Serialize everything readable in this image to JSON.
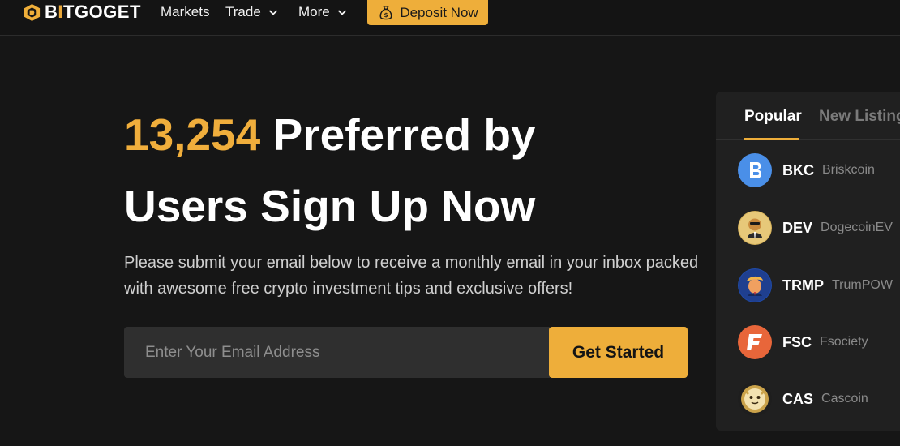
{
  "brand": {
    "name_prefix": "B",
    "name_i": "I",
    "name_suffix": "TGOGET",
    "accent": "#eeae3a"
  },
  "nav": {
    "items": [
      {
        "label": "Markets"
      },
      {
        "label": "Trade"
      },
      {
        "label": "More"
      }
    ],
    "deposit_label": "Deposit Now"
  },
  "hero": {
    "count": "13,254",
    "title_rest_line1": " Preferred by",
    "title_line2": "Users Sign Up Now",
    "subtitle": "Please submit your email below to receive a monthly email in your inbox packed with awesome free crypto investment tips and exclusive offers!",
    "email_placeholder": "Enter Your Email Address",
    "cta_label": "Get Started"
  },
  "panel": {
    "tabs": [
      {
        "label": "Popular",
        "active": true
      },
      {
        "label": "New Listing",
        "active": false
      }
    ],
    "coins": [
      {
        "symbol": "BKC",
        "name": "Briskcoin",
        "icon": "briskcoin-icon",
        "color": "#4a8fe8"
      },
      {
        "symbol": "DEV",
        "name": "DogecoinEV",
        "icon": "dogecoinev-icon",
        "color": "#d6b25a"
      },
      {
        "symbol": "TRMP",
        "name": "TrumPOW",
        "icon": "trumpow-icon",
        "color": "#1f4aa8"
      },
      {
        "symbol": "FSC",
        "name": "Fsociety",
        "icon": "fsociety-icon",
        "color": "#e8663a"
      },
      {
        "symbol": "CAS",
        "name": "Cascoin",
        "icon": "cascoin-icon",
        "color": "#c9a24a"
      }
    ]
  }
}
